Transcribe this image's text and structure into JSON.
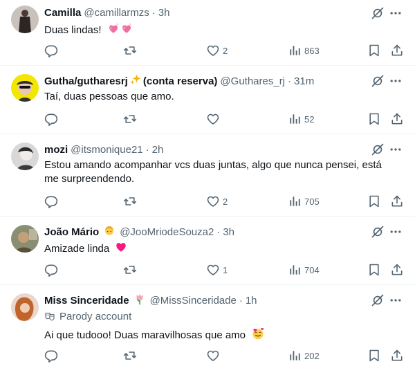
{
  "colors": {
    "text": "#0f1419",
    "muted": "#536471",
    "heart": "#f91880",
    "divider": "#eff3f4"
  },
  "tweets": [
    {
      "name": "Camilla",
      "name_emoji": "",
      "handle": "@camillarmzs",
      "time": "3h",
      "text": "Duas lindas!",
      "text_emoji": "sparkling-hearts",
      "parody": "",
      "likes": "2",
      "views": "863"
    },
    {
      "name": "Gutha/gutharesrj",
      "name_emoji": "sparkles",
      "name_suffix": "(conta reserva)",
      "handle": "@Guthares_rj",
      "time": "31m",
      "text": "Taí, duas pessoas que amo.",
      "text_emoji": "",
      "parody": "",
      "likes": "",
      "views": "52"
    },
    {
      "name": "mozi",
      "name_emoji": "",
      "handle": "@itsmonique21",
      "time": "2h",
      "text": "Estou amando acompanhar vcs duas juntas, algo que nunca pensei, está me surpreendendo.",
      "text_emoji": "",
      "parody": "",
      "likes": "2",
      "views": "705"
    },
    {
      "name": "João Mário",
      "name_emoji": "blond-person",
      "handle": "@JooMriodeSouza2",
      "time": "3h",
      "text": "Amizade linda",
      "text_emoji": "red-heart",
      "parody": "",
      "likes": "1",
      "views": "704"
    },
    {
      "name": "Miss Sinceridade",
      "name_emoji": "tulip",
      "handle": "@MissSinceridade",
      "time": "1h",
      "text": "Ai que tudooo! Duas maravilhosas que amo",
      "text_emoji": "smiling-face-with-hearts",
      "parody": "Parody account",
      "likes": "",
      "views": "202"
    }
  ],
  "meta": {
    "dot": "·"
  }
}
